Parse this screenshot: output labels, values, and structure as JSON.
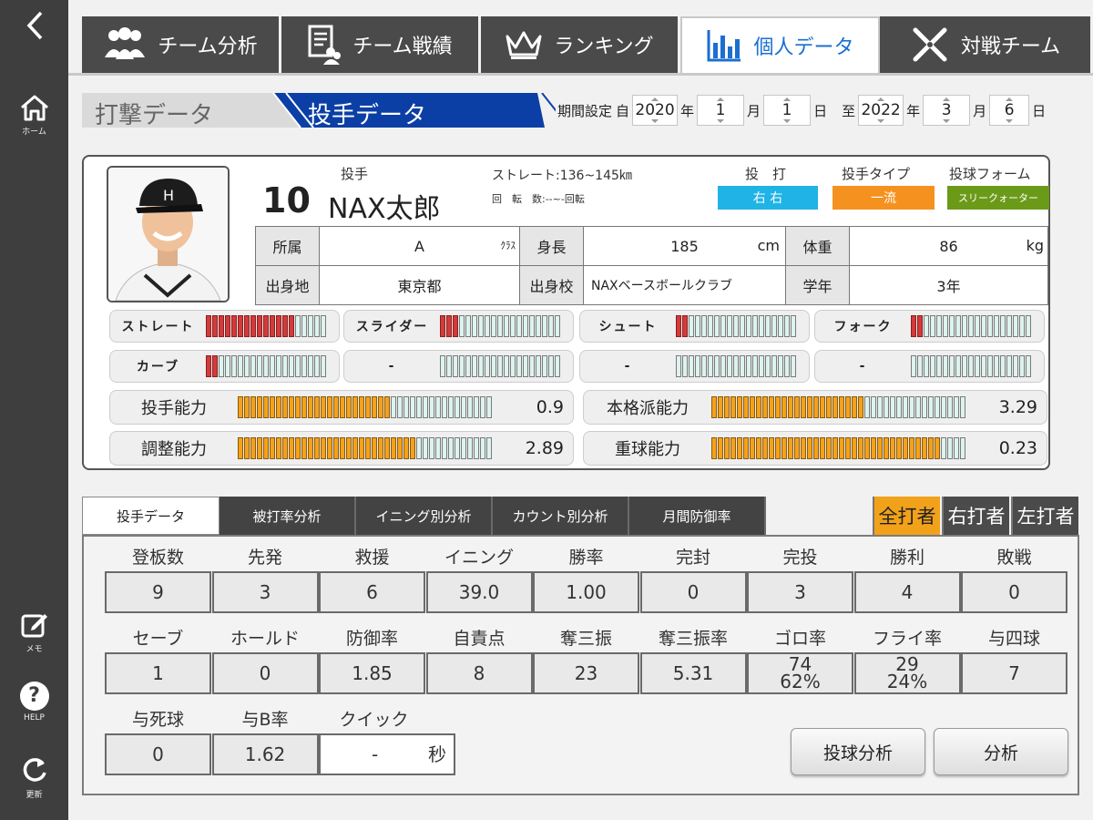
{
  "sidebar": {
    "back_icon": "chevron-left-icon",
    "items": [
      {
        "icon": "home-icon",
        "label": "ホーム"
      },
      {
        "icon": "memo-icon",
        "label": "メモ"
      },
      {
        "icon": "help-icon",
        "label": "HELP",
        "glyph": "?"
      },
      {
        "icon": "refresh-icon",
        "label": "更新"
      }
    ]
  },
  "tabs": [
    {
      "label": "チーム分析",
      "icon": "team-icon"
    },
    {
      "label": "チーム戦績",
      "icon": "team-record-icon"
    },
    {
      "label": "ランキング",
      "icon": "crown-icon"
    },
    {
      "label": "個人データ",
      "icon": "bar-chart-icon",
      "active": true
    },
    {
      "label": "対戦チーム",
      "icon": "crossed-bats-icon"
    }
  ],
  "subtabs": {
    "batting": "打撃データ",
    "pitching": "投手データ"
  },
  "period": {
    "label": "期間設定",
    "from_prefix": "自",
    "to_prefix": "至",
    "from": {
      "year": "2020",
      "month": "1",
      "day": "1"
    },
    "to": {
      "year": "2022",
      "month": "3",
      "day": "6"
    },
    "year_unit": "年",
    "month_unit": "月",
    "day_unit": "日"
  },
  "player": {
    "position": "投手",
    "number": "10",
    "name": "NAX太郎",
    "straight_speed": "ストレート:136~145㎞",
    "rotation": "回　転　数:--~-回転",
    "throw_bat_label": "投　打",
    "throw_bat": "右 右",
    "pitcher_type_label": "投手タイプ",
    "pitcher_type": "一流",
    "form_label": "投球フォーム",
    "form": "スリークォーター",
    "info": {
      "team_h": "所属",
      "team": "A",
      "team_unit": "ｸﾗｽ",
      "height_h": "身長",
      "height": "185",
      "height_unit": "cm",
      "weight_h": "体重",
      "weight": "86",
      "weight_unit": "kg",
      "birthplace_h": "出身地",
      "birthplace": "東京都",
      "school_h": "出身校",
      "school": "NAXベースボールクラブ",
      "grade_h": "学年",
      "grade": "3年"
    }
  },
  "pitches": [
    {
      "name": "ストレート",
      "level": 0.74
    },
    {
      "name": "スライダー",
      "level": 0.15
    },
    {
      "name": "シュート",
      "level": 0.12
    },
    {
      "name": "フォーク",
      "level": 0.08
    },
    {
      "name": "カーブ",
      "level": 0.08
    },
    {
      "name": "-",
      "level": 0
    },
    {
      "name": "-",
      "level": 0
    },
    {
      "name": "-",
      "level": 0
    }
  ],
  "abilities": [
    {
      "name": "投手能力",
      "value": "0.9",
      "level": 0.6
    },
    {
      "name": "本格派能力",
      "value": "3.29",
      "level": 0.6
    },
    {
      "name": "調整能力",
      "value": "2.89",
      "level": 0.7
    },
    {
      "name": "重球能力",
      "value": "0.23",
      "level": 0.9
    }
  ],
  "data_tabs": [
    "投手データ",
    "被打率分析",
    "イニング別分析",
    "カウント別分析",
    "月間防御率"
  ],
  "hand_tabs": [
    "全打者",
    "右打者",
    "左打者"
  ],
  "stats": [
    [
      {
        "label": "登板数",
        "value": "9"
      },
      {
        "label": "先発",
        "value": "3"
      },
      {
        "label": "救援",
        "value": "6"
      },
      {
        "label": "イニング",
        "value": "39.0"
      },
      {
        "label": "勝率",
        "value": "1.00"
      },
      {
        "label": "完封",
        "value": "0"
      },
      {
        "label": "完投",
        "value": "3"
      },
      {
        "label": "勝利",
        "value": "4"
      },
      {
        "label": "敗戦",
        "value": "0"
      }
    ],
    [
      {
        "label": "セーブ",
        "value": "1"
      },
      {
        "label": "ホールド",
        "value": "0"
      },
      {
        "label": "防御率",
        "value": "1.85"
      },
      {
        "label": "自責点",
        "value": "8"
      },
      {
        "label": "奪三振",
        "value": "23"
      },
      {
        "label": "奪三振率",
        "value": "5.31"
      },
      {
        "label": "ゴロ率",
        "value": "74",
        "sub": "62%"
      },
      {
        "label": "フライ率",
        "value": "29",
        "sub": "24%"
      },
      {
        "label": "与四球",
        "value": "7"
      }
    ],
    [
      {
        "label": "与死球",
        "value": "0"
      },
      {
        "label": "与B率",
        "value": "1.62"
      }
    ]
  ],
  "quick": {
    "label": "クイック",
    "value": "-",
    "unit": "秒"
  },
  "buttons": {
    "pitch_analysis": "投球分析",
    "analysis": "分析"
  },
  "colors": {
    "sidebar": "#3e3e3e",
    "active_tab_text": "#1a6fd1",
    "pitching_subtab": "#0b3fa6",
    "throw_bat_pill": "#1fb3e6",
    "pitcher_type_pill": "#f5921f",
    "form_pill": "#6b9a19",
    "bar_red": "#d43a3a",
    "bar_orange": "#f3a21b",
    "hand_active": "#f1a21a"
  }
}
